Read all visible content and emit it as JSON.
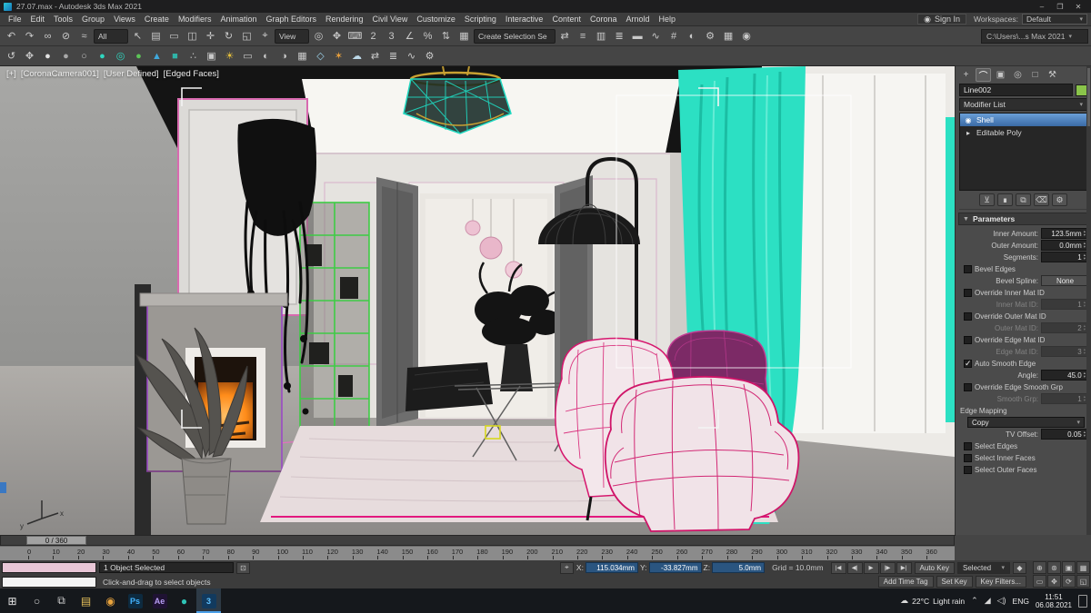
{
  "window": {
    "title": "27.07.max - Autodesk 3ds Max 2021",
    "minimize": "–",
    "maximize": "❐",
    "close": "✕"
  },
  "menu": {
    "items": [
      "File",
      "Edit",
      "Tools",
      "Group",
      "Views",
      "Create",
      "Modifiers",
      "Animation",
      "Graph Editors",
      "Rendering",
      "Civil View",
      "Customize",
      "Scripting",
      "Interactive",
      "Content",
      "Corona",
      "Arnold",
      "Help"
    ],
    "sign_in": "Sign In",
    "person_glyph": "◉",
    "workspaces_label": "Workspaces:",
    "workspaces_value": "Default"
  },
  "toolbar1": {
    "project_path": "C:\\Users\\...s Max 2021",
    "items": [
      {
        "name": "undo-icon",
        "glyph": "↶"
      },
      {
        "name": "redo-icon",
        "glyph": "↷"
      },
      {
        "name": "select-and-link-icon",
        "glyph": "∞"
      },
      {
        "name": "unlink-selection-icon",
        "glyph": "⊘"
      },
      {
        "name": "bind-to-space-warp-icon",
        "glyph": "≈"
      },
      {
        "type": "dd",
        "name": "selection-filter-dropdown",
        "label": "All",
        "caret": " "
      },
      {
        "name": "select-object-icon",
        "glyph": "↖"
      },
      {
        "name": "select-by-name-icon",
        "glyph": "▤"
      },
      {
        "name": "rectangular-selection-region-icon",
        "glyph": "▭"
      },
      {
        "name": "window-crossing-toggle-icon",
        "glyph": "◫"
      },
      {
        "name": "select-and-move-icon",
        "glyph": "✛"
      },
      {
        "name": "select-and-rotate-icon",
        "glyph": "↻"
      },
      {
        "name": "select-and-scale-icon",
        "glyph": "◱"
      },
      {
        "name": "select-and-place-icon",
        "glyph": "⌖"
      },
      {
        "type": "dd",
        "name": "reference-coordinate-dropdown",
        "label": "View",
        "caret": " "
      },
      {
        "name": "use-pivot-center-icon",
        "glyph": "◎"
      },
      {
        "name": "select-and-manipulate-icon",
        "glyph": "✥"
      },
      {
        "name": "keyboard-shortcut-override-icon",
        "glyph": "⌨"
      },
      {
        "name": "snap-2d-toggle-icon",
        "glyph": "2"
      },
      {
        "name": "snap-3d-toggle-icon",
        "glyph": "3"
      },
      {
        "name": "angle-snap-toggle-icon",
        "glyph": "∠"
      },
      {
        "name": "percent-snap-toggle-icon",
        "glyph": "%"
      },
      {
        "name": "spinner-snap-toggle-icon",
        "glyph": "⇅"
      },
      {
        "name": "edit-named-selection-sets-icon",
        "glyph": "▦"
      },
      {
        "type": "dd",
        "name": "named-selection-sets-dropdown",
        "label": "Create Selection Se",
        "caret": " "
      },
      {
        "name": "mirror-icon",
        "glyph": "⇄"
      },
      {
        "name": "align-icon",
        "glyph": "≡"
      },
      {
        "name": "toggle-scene-explorer-icon",
        "glyph": "▥"
      },
      {
        "name": "toggle-layer-explorer-icon",
        "glyph": "≣"
      },
      {
        "name": "toggle-ribbon-icon",
        "glyph": "▬"
      },
      {
        "name": "curve-editor-icon",
        "glyph": "∿"
      },
      {
        "name": "schematic-view-icon",
        "glyph": "#"
      },
      {
        "name": "material-editor-icon",
        "glyph": "◐"
      },
      {
        "name": "render-setup-icon",
        "glyph": "⚙"
      },
      {
        "name": "rendered-frame-window-icon",
        "glyph": "▦"
      },
      {
        "name": "render-production-icon",
        "glyph": "◉"
      }
    ]
  },
  "toolbar2": {
    "items": [
      {
        "name": "undo-view-icon",
        "glyph": "↺"
      },
      {
        "name": "pan-view-icon",
        "glyph": "✥"
      },
      {
        "name": "white-sphere-icon",
        "glyph": "●",
        "color": "#e2e2e2"
      },
      {
        "name": "gray-sphere-icon",
        "glyph": "●",
        "color": "#a8a8a8"
      },
      {
        "name": "capsule-icon",
        "glyph": "○",
        "color": "#bdbdbd"
      },
      {
        "name": "teal-sphere-icon",
        "glyph": "●",
        "color": "#2fd6bf"
      },
      {
        "name": "teal-torus-icon",
        "glyph": "◎",
        "color": "#2fd6bf"
      },
      {
        "name": "green-sphere-icon",
        "glyph": "●",
        "color": "#5cc457"
      },
      {
        "name": "blue-cone-icon",
        "glyph": "▲",
        "color": "#3fa8dc"
      },
      {
        "name": "teal-cube-icon",
        "glyph": "■",
        "color": "#2fb4a8"
      },
      {
        "name": "scatter-icon",
        "glyph": "∴",
        "color": "#b8b8b8"
      },
      {
        "name": "camera-icon",
        "glyph": "▣"
      },
      {
        "name": "light-icon",
        "glyph": "☀",
        "color": "#e8c23c"
      },
      {
        "name": "render-region-icon",
        "glyph": "▭"
      },
      {
        "name": "material-override-icon",
        "glyph": "◐"
      },
      {
        "name": "exposure-icon",
        "glyph": "◑"
      },
      {
        "name": "lut-icon",
        "glyph": "▦"
      },
      {
        "name": "proxy-icon",
        "glyph": "◇",
        "color": "#9ad0e8"
      },
      {
        "name": "sun-icon",
        "glyph": "✶",
        "color": "#e8a03c"
      },
      {
        "name": "sky-icon",
        "glyph": "☁",
        "color": "#bcd8e8"
      },
      {
        "name": "convert-icon",
        "glyph": "⇄"
      },
      {
        "name": "list-icon",
        "glyph": "≣"
      },
      {
        "name": "graph-icon",
        "glyph": "∿"
      },
      {
        "name": "settings-icon",
        "glyph": "⚙"
      }
    ]
  },
  "viewport": {
    "label_plus": "[+]",
    "label_camera": "[CoronaCamera001]",
    "label_user": "[User Defined]",
    "label_shading": "[Edged Faces]",
    "axis_x": "x",
    "axis_y": "y"
  },
  "command_panel": {
    "tabs": [
      {
        "name": "create-tab",
        "glyph": "+"
      },
      {
        "name": "modify-tab",
        "glyph": "⌒",
        "active": true
      },
      {
        "name": "hierarchy-tab",
        "glyph": "▣"
      },
      {
        "name": "motion-tab",
        "glyph": "◎"
      },
      {
        "name": "display-tab",
        "glyph": "□"
      },
      {
        "name": "utilities-tab",
        "glyph": "⚒"
      }
    ],
    "object_name": "Line002",
    "modifier_list_label": "Modifier List",
    "stack": [
      {
        "name": "modifier-shell",
        "label": "Shell",
        "icon": "◉",
        "selected": true
      },
      {
        "name": "base-object-editable-poly",
        "label": "Editable Poly",
        "icon": "▸"
      }
    ],
    "stack_buttons": [
      {
        "name": "pin-stack-button",
        "glyph": "⊻"
      },
      {
        "name": "show-end-result-button",
        "glyph": "∎"
      },
      {
        "name": "make-unique-button",
        "glyph": "⧉"
      },
      {
        "name": "remove-modifier-button",
        "glyph": "⌫"
      },
      {
        "name": "configure-modifier-sets-button",
        "glyph": "⚙"
      }
    ],
    "rollout_title": "Parameters",
    "params": [
      {
        "type": "spinner",
        "name": "inner-amount-spinner",
        "label": "Inner Amount:",
        "value": "123.5mm"
      },
      {
        "type": "spinner",
        "name": "outer-amount-spinner",
        "label": "Outer Amount:",
        "value": "0.0mm"
      },
      {
        "type": "spinner",
        "name": "segments-spinner",
        "label": "Segments:",
        "value": "1"
      },
      {
        "type": "checkbox",
        "name": "bevel-edges-checkbox",
        "label": "Bevel Edges"
      },
      {
        "type": "button",
        "name": "bevel-spline-button",
        "label": "Bevel Spline:",
        "value": "None"
      },
      {
        "type": "checkbox",
        "name": "override-inner-mat-id-checkbox",
        "label": "Override Inner Mat ID"
      },
      {
        "type": "spinner",
        "name": "inner-mat-id-spinner",
        "label": "Inner Mat ID:",
        "value": "1",
        "disabled": true
      },
      {
        "type": "checkbox",
        "name": "override-outer-mat-id-checkbox",
        "label": "Override Outer Mat ID"
      },
      {
        "type": "spinner",
        "name": "outer-mat-id-spinner",
        "label": "Outer Mat ID:",
        "value": "2",
        "disabled": true
      },
      {
        "type": "checkbox",
        "name": "override-edge-mat-id-checkbox",
        "label": "Override Edge Mat ID"
      },
      {
        "type": "spinner",
        "name": "edge-mat-id-spinner",
        "label": "Edge Mat ID:",
        "value": "3",
        "disabled": true
      },
      {
        "type": "checkbox",
        "name": "auto-smooth-edge-checkbox",
        "label": "Auto Smooth Edge",
        "checked": true
      },
      {
        "type": "spinner",
        "name": "angle-spinner",
        "label": "Angle:",
        "value": "45.0"
      },
      {
        "type": "checkbox",
        "name": "override-edge-smooth-grp-checkbox",
        "label": "Override Edge Smooth Grp"
      },
      {
        "type": "spinner",
        "name": "smooth-grp-spinner",
        "label": "Smooth Grp:",
        "value": "1",
        "disabled": true
      },
      {
        "type": "label",
        "name": "edge-mapping-label",
        "label": "Edge Mapping"
      },
      {
        "type": "dropdown",
        "name": "edge-mapping-dropdown",
        "value": "Copy"
      },
      {
        "type": "spinner",
        "name": "tv-offset-spinner",
        "label": "TV Offset:",
        "value": "0.05"
      },
      {
        "type": "checkbox",
        "name": "select-edges-checkbox",
        "label": "Select Edges"
      },
      {
        "type": "checkbox",
        "name": "select-inner-faces-checkbox",
        "label": "Select Inner Faces"
      },
      {
        "type": "checkbox",
        "name": "select-outer-faces-checkbox",
        "label": "Select Outer Faces"
      }
    ]
  },
  "time_slider": {
    "value": "0 / 360"
  },
  "timeline": {
    "ticks": [
      "0",
      "10",
      "20",
      "30",
      "40",
      "50",
      "60",
      "70",
      "80",
      "90",
      "100",
      "110",
      "120",
      "130",
      "140",
      "150",
      "160",
      "170",
      "180",
      "190",
      "200",
      "210",
      "220",
      "230",
      "240",
      "250",
      "260",
      "270",
      "280",
      "290",
      "300",
      "310",
      "320",
      "330",
      "340",
      "350",
      "360"
    ]
  },
  "status": {
    "selection_text": "1 Object Selected",
    "lock_glyph": "⊡",
    "abs_mode_glyph": "⌖",
    "x_label": "X:",
    "x_value": "115.034mm",
    "y_label": "Y:",
    "y_value": "-33.827mm",
    "z_label": "Z:",
    "z_value": "5.0mm",
    "grid": "Grid = 10.0mm",
    "prompt": "Click-and-drag to select objects",
    "add_time_tag": "Add Time Tag",
    "auto_key": "Auto Key",
    "selected_dd": "Selected",
    "key_tangents_glyph": "◆",
    "set_key": "Set Key",
    "key_filters": "Key Filters...",
    "transport": [
      {
        "name": "go-to-start-button",
        "glyph": "|◀"
      },
      {
        "name": "previous-frame-button",
        "glyph": "◀|"
      },
      {
        "name": "play-animation-button",
        "glyph": "▶"
      },
      {
        "name": "next-frame-button",
        "glyph": "|▶"
      },
      {
        "name": "go-to-end-button",
        "glyph": "▶|"
      }
    ],
    "nav": [
      {
        "name": "zoom-button",
        "glyph": "⊕"
      },
      {
        "name": "zoom-all-button",
        "glyph": "⊛"
      },
      {
        "name": "zoom-extents-button",
        "glyph": "▣"
      },
      {
        "name": "zoom-extents-all-button",
        "glyph": "▦"
      },
      {
        "name": "zoom-region-button",
        "glyph": "▭"
      },
      {
        "name": "pan-button",
        "glyph": "✥"
      },
      {
        "name": "orbit-button",
        "glyph": "⟳"
      },
      {
        "name": "maximize-viewport-button",
        "glyph": "◱"
      }
    ]
  },
  "taskbar": {
    "apps": [
      {
        "name": "start-button",
        "glyph": "⊞",
        "color": "#e8e8e8"
      },
      {
        "name": "search-button",
        "glyph": "○",
        "color": "#cfcfcf"
      },
      {
        "name": "task-view-button",
        "glyph": "⧉",
        "color": "#cfcfcf"
      },
      {
        "name": "file-explorer-button",
        "glyph": "▤",
        "color": "#e9c35c"
      },
      {
        "name": "chrome-button",
        "glyph": "◉",
        "color": "#e8a33d"
      },
      {
        "name": "photoshop-button",
        "label": "Ps",
        "bg": "#0d2a3f",
        "color": "#43b4ff"
      },
      {
        "name": "after-effects-button",
        "label": "Ae",
        "bg": "#1f1233",
        "color": "#b59df2"
      },
      {
        "name": "lightroom-button",
        "glyph": "●",
        "color": "#2ec4b6"
      },
      {
        "name": "3ds-max-running-button",
        "label": "3",
        "bg": "#123a5e",
        "color": "#5ec2ff",
        "active": true
      }
    ],
    "tray": {
      "weather_glyph": "☁",
      "weather_temp": "22°C",
      "weather_desc": "Light rain",
      "hidden_glyph": "⌃",
      "network_glyph": "◢",
      "volume_glyph": "◁)",
      "lang": "ENG",
      "time": "11:51",
      "date": "06.08.2021"
    }
  }
}
